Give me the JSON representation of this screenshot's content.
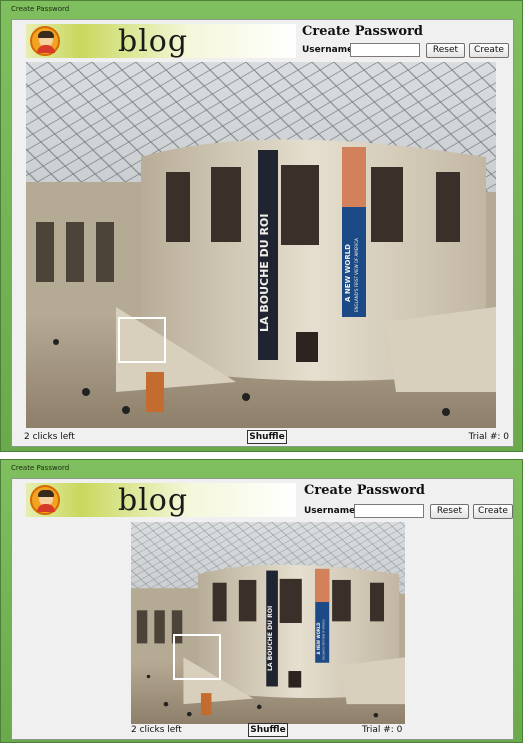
{
  "window_title": "Create Password",
  "logo_text": "blog",
  "panel_title": "Create Password",
  "username_label": "Username",
  "username_value": "",
  "buttons": {
    "reset": "Reset",
    "create": "Create",
    "shuffle": "Shuffle"
  },
  "status": {
    "clicks_left": "2 clicks left",
    "trial": "Trial #: 0"
  },
  "photo_banners": {
    "left": "LA BOUCHE DU ROI",
    "right_main": "A NEW WORLD",
    "right_sub": "ENGLAND'S FIRST VIEW OF AMERICA"
  }
}
